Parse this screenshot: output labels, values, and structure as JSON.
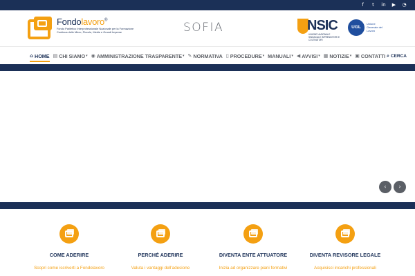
{
  "topbar": {
    "social": [
      {
        "icon": "facebook-icon",
        "glyph": "f"
      },
      {
        "icon": "twitter-icon",
        "glyph": "t"
      },
      {
        "icon": "linkedin-icon",
        "glyph": "in"
      },
      {
        "icon": "youtube-icon",
        "glyph": "▶"
      },
      {
        "icon": "rss-icon",
        "glyph": "◔"
      }
    ]
  },
  "header": {
    "logo_name_part1": "Fondo",
    "logo_name_part2": "lavoro",
    "logo_reg": "®",
    "logo_subtitle": "Fondo Paritetico Interprofessionale Nazionale per la Formazione Continua delle Micro, Piccole, Medie e Grandi Imprese",
    "sofia_logo": "SOFIA",
    "nsic_logo": "NSIC",
    "nsic_subtitle": "UNIONE NAZIONALE SINDACALE IMPRENDITORI E COLTIVATORI",
    "ugl_logo": "UGL",
    "ugl_subtitle": "Unione Generale del Lavoro"
  },
  "nav": {
    "items": [
      {
        "label": "HOME",
        "icon": "home-icon",
        "glyph": "⌂",
        "active": true,
        "dropdown": false
      },
      {
        "label": "CHI SIAMO",
        "icon": "id-card-icon",
        "glyph": "▤",
        "active": false,
        "dropdown": true
      },
      {
        "label": "AMMINISTRAZIONE TRASPARENTE",
        "icon": "eye-icon",
        "glyph": "◉",
        "active": false,
        "dropdown": true
      },
      {
        "label": "NORMATIVA",
        "icon": "wrench-icon",
        "glyph": "✎",
        "active": false,
        "dropdown": false
      },
      {
        "label": "PROCEDURE",
        "icon": "document-icon",
        "glyph": "▯",
        "active": false,
        "dropdown": true
      },
      {
        "label": "MANUALI",
        "icon": "",
        "glyph": "",
        "active": false,
        "dropdown": true
      },
      {
        "label": "AVVISI",
        "icon": "megaphone-icon",
        "glyph": "◀",
        "active": false,
        "dropdown": true
      },
      {
        "label": "NOTIZIE",
        "icon": "newspaper-icon",
        "glyph": "▦",
        "active": false,
        "dropdown": true
      },
      {
        "label": "CONTATTI",
        "icon": "contact-form-icon",
        "glyph": "▣",
        "active": false,
        "dropdown": false
      }
    ],
    "search_label": "CERCA",
    "search_glyph": "⌕"
  },
  "slider": {
    "prev_glyph": "‹",
    "next_glyph": "›"
  },
  "features": [
    {
      "title": "COME ADERIRE",
      "desc": "Scopri come iscriverti a Fondolavoro"
    },
    {
      "title": "PERCHÉ ADERIRE",
      "desc": "Valuta i vantaggi dell'adesione"
    },
    {
      "title": "DIVENTA ENTE ATTUATORE",
      "desc": "Inizia ad organizzare piani formativi"
    },
    {
      "title": "DIVENTA REVISORE LEGALE",
      "desc": "Acquisisci incarichi professionali"
    }
  ],
  "colors": {
    "navy": "#1b3057",
    "orange": "#f4a012",
    "nav_text": "#5a5d63"
  }
}
